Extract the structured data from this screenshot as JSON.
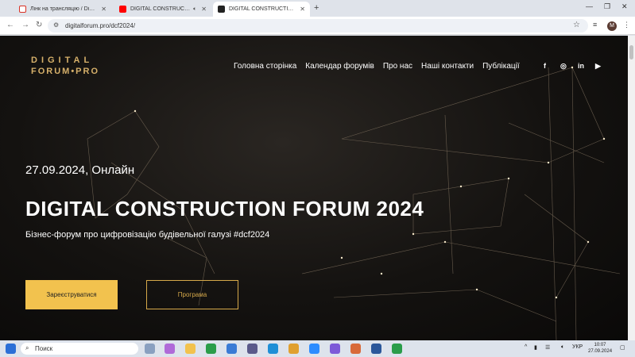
{
  "browser": {
    "tabs": [
      {
        "title": "Лінк на трансляцію / Digital C",
        "icon": "gmail-icon",
        "color": "#d93025"
      },
      {
        "title": "DIGITAL CONSTRUCTION F",
        "icon": "youtube-icon",
        "color": "#ff0000"
      },
      {
        "title": "DIGITAL CONSTRUCTION FOR",
        "icon": "dcf-icon",
        "color": "#222222"
      }
    ],
    "url": "digitalforum.pro/dcf2024/",
    "profile_letter": "M"
  },
  "site": {
    "logo_line1": "DIGITAL",
    "logo_line2": "FORUM•PRO",
    "nav": [
      "Головна сторінка",
      "Календар форумів",
      "Про нас",
      "Наші контакти",
      "Публікації"
    ],
    "social": [
      "f",
      "◎",
      "in",
      "▶"
    ],
    "date": "27.09.2024, Онлайн",
    "headline": "DIGITAL CONSTRUCTION FORUM 2024",
    "subtitle": "Бізнес-форум про цифровізацію будівельної галузі #dcf2024",
    "register_label": "Зареєструватися",
    "program_label": "Програма",
    "accent": "#f2c24e",
    "gold": "#d6b06a"
  },
  "taskbar": {
    "search_label": "Поиск",
    "lang": "УКР",
    "time": "10:07",
    "date": "27.09.2024"
  }
}
